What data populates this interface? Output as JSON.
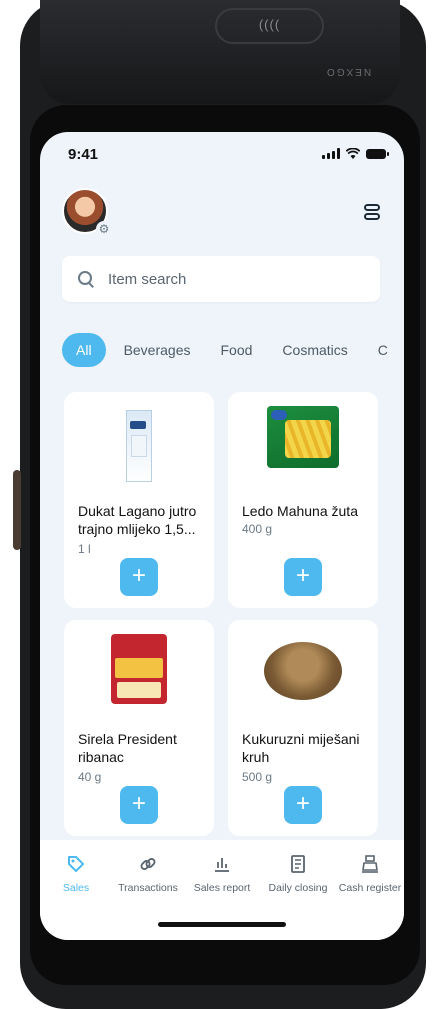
{
  "device": {
    "nfc_mark": "((((",
    "brand": "NEXGO"
  },
  "status_bar": {
    "time": "9:41"
  },
  "header": {
    "avatar_icon": "user-avatar",
    "settings_icon": "gear-icon",
    "menu_icon": "layers-icon"
  },
  "search": {
    "placeholder": "Item search",
    "value": ""
  },
  "categories": [
    {
      "label": "All",
      "active": true
    },
    {
      "label": "Beverages",
      "active": false
    },
    {
      "label": "Food",
      "active": false
    },
    {
      "label": "Cosmatics",
      "active": false
    },
    {
      "label": "C",
      "active": false
    }
  ],
  "products": [
    {
      "name": "Dukat Lagano jutro trajno mlijeko 1,5...",
      "quantity": "1 l",
      "add_label": "+"
    },
    {
      "name": "Ledo Mahuna žuta",
      "quantity": "400 g",
      "add_label": "+"
    },
    {
      "name": "Sirela President ribanac",
      "quantity": "40 g",
      "add_label": "+"
    },
    {
      "name": "Kukuruzni miješani kruh",
      "quantity": "500 g",
      "add_label": "+"
    }
  ],
  "bottom_nav": [
    {
      "label": "Sales",
      "icon": "tag-icon",
      "active": true
    },
    {
      "label": "Transactions",
      "icon": "link-icon",
      "active": false
    },
    {
      "label": "Sales report",
      "icon": "bar-chart-icon",
      "active": false
    },
    {
      "label": "Daily closing",
      "icon": "ledger-icon",
      "active": false
    },
    {
      "label": "Cash register",
      "icon": "cash-register-icon",
      "active": false
    }
  ],
  "colors": {
    "accent": "#4DB9EE",
    "screen_bg": "#EEF4F9",
    "card_bg": "#FFFFFF",
    "device_body": "#1C1D1F"
  }
}
